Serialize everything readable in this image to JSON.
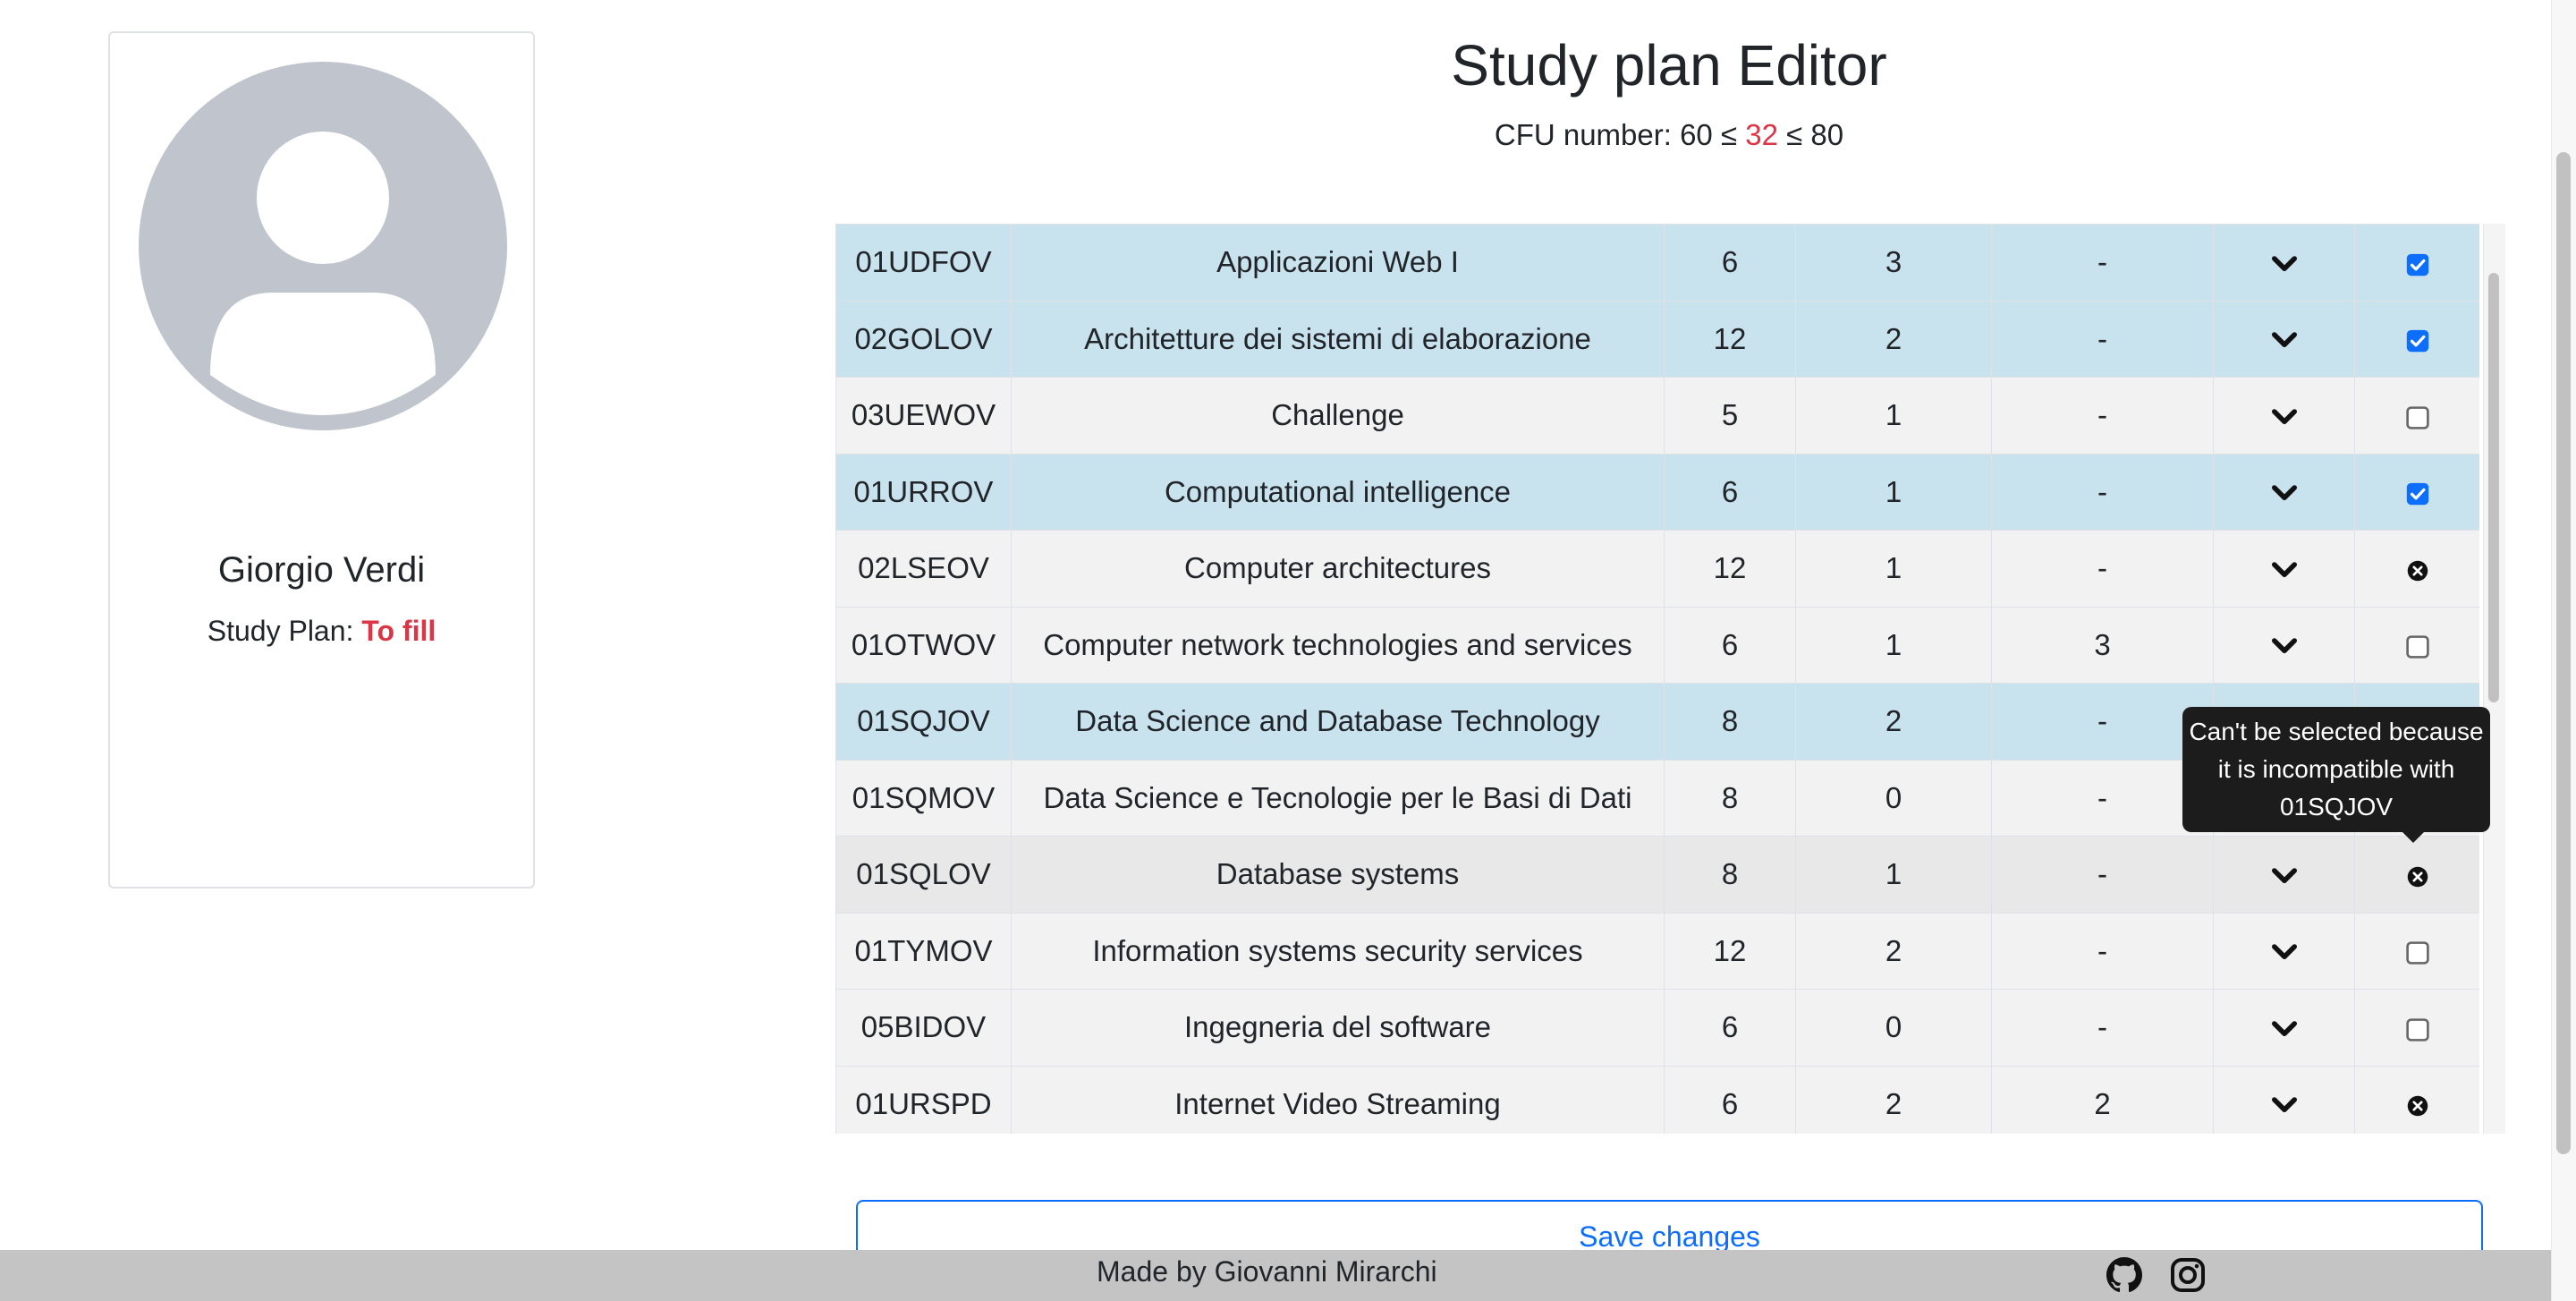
{
  "profile": {
    "name": "Giorgio Verdi",
    "plan_label": "Study Plan:",
    "plan_status": "To fill"
  },
  "header": {
    "title": "Study plan Editor",
    "cfu_prefix": "CFU number: 60 ≤",
    "cfu_current": "32",
    "cfu_suffix": "≤ 80"
  },
  "courses": [
    {
      "code": "01UDFOV",
      "name": "Applicazioni Web I",
      "credits": "6",
      "enrolled": "3",
      "max": "-",
      "state": "checked"
    },
    {
      "code": "02GOLOV",
      "name": "Architetture dei sistemi di elaborazione",
      "credits": "12",
      "enrolled": "2",
      "max": "-",
      "state": "checked"
    },
    {
      "code": "03UEWOV",
      "name": "Challenge",
      "credits": "5",
      "enrolled": "1",
      "max": "-",
      "state": "unchecked"
    },
    {
      "code": "01URROV",
      "name": "Computational intelligence",
      "credits": "6",
      "enrolled": "1",
      "max": "-",
      "state": "checked"
    },
    {
      "code": "02LSEOV",
      "name": "Computer architectures",
      "credits": "12",
      "enrolled": "1",
      "max": "-",
      "state": "blocked"
    },
    {
      "code": "01OTWOV",
      "name": "Computer network technologies and services",
      "credits": "6",
      "enrolled": "1",
      "max": "3",
      "state": "unchecked"
    },
    {
      "code": "01SQJOV",
      "name": "Data Science and Database Technology",
      "credits": "8",
      "enrolled": "2",
      "max": "-",
      "state": "checked"
    },
    {
      "code": "01SQMOV",
      "name": "Data Science e Tecnologie per le Basi di Dati",
      "credits": "8",
      "enrolled": "0",
      "max": "-",
      "state": "blocked"
    },
    {
      "code": "01SQLOV",
      "name": "Database systems",
      "credits": "8",
      "enrolled": "1",
      "max": "-",
      "state": "blocked"
    },
    {
      "code": "01TYMOV",
      "name": "Information systems security services",
      "credits": "12",
      "enrolled": "2",
      "max": "-",
      "state": "unchecked"
    },
    {
      "code": "05BIDOV",
      "name": "Ingegneria del software",
      "credits": "6",
      "enrolled": "0",
      "max": "-",
      "state": "unchecked"
    },
    {
      "code": "01URSPD",
      "name": "Internet Video Streaming",
      "credits": "6",
      "enrolled": "2",
      "max": "2",
      "state": "blocked"
    }
  ],
  "tooltip": {
    "line1": "Can't be selected because",
    "line2": "it is incompatible with",
    "line3": "01SQJOV"
  },
  "save_label": "Save changes",
  "footer": {
    "text": "Made by Giovanni Mirarchi",
    "icons": [
      "github-icon",
      "instagram-icon"
    ]
  },
  "colors": {
    "selected_row": "#c8e2ee",
    "default_row": "#f2f2f2",
    "accent": "#0d6efd",
    "danger": "#dc3545"
  }
}
